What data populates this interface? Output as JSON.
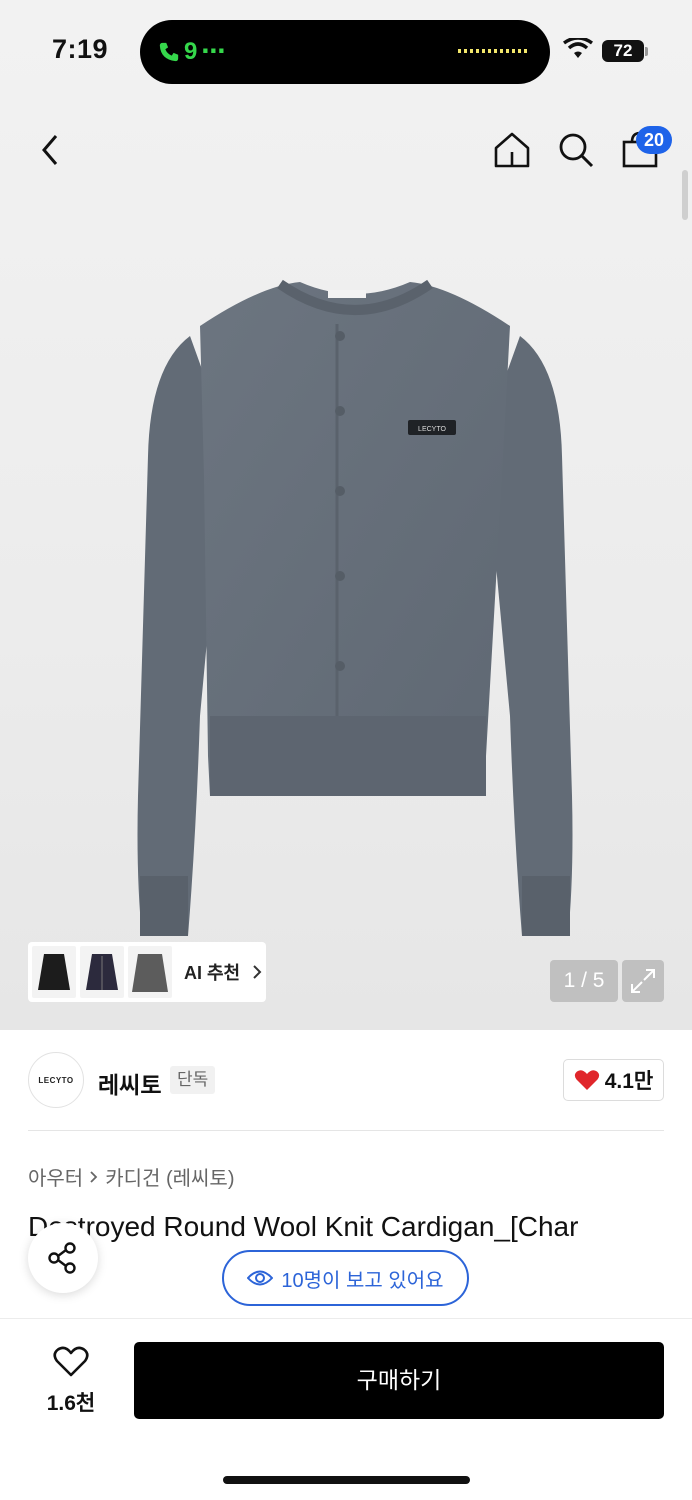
{
  "status_bar": {
    "time": "7:19",
    "call_label": "9",
    "battery": "72"
  },
  "nav": {
    "cart_count": "20"
  },
  "gallery": {
    "ai_recommend_label": "AI 추천",
    "pager": "1 / 5",
    "product_logo_text": "LECYTO"
  },
  "brand": {
    "logo_text": "LECYTO",
    "name": "레씨토",
    "tag": "단독",
    "likes": "4.1만"
  },
  "breadcrumb": {
    "category": "아우터",
    "subcategory": "카디건 (레씨토)"
  },
  "product": {
    "title_line1": "Destroyed Round Wool Knit Cardigan_[Char",
    "viewers": "10명이 보고 있어요"
  },
  "bottom": {
    "wish_count": "1.6천",
    "buy_label": "구매하기"
  },
  "colors": {
    "accent_blue": "#1e63e9",
    "viewer_blue": "#2c64d8",
    "heart_red": "#e0262b",
    "buy_black": "#000000"
  }
}
